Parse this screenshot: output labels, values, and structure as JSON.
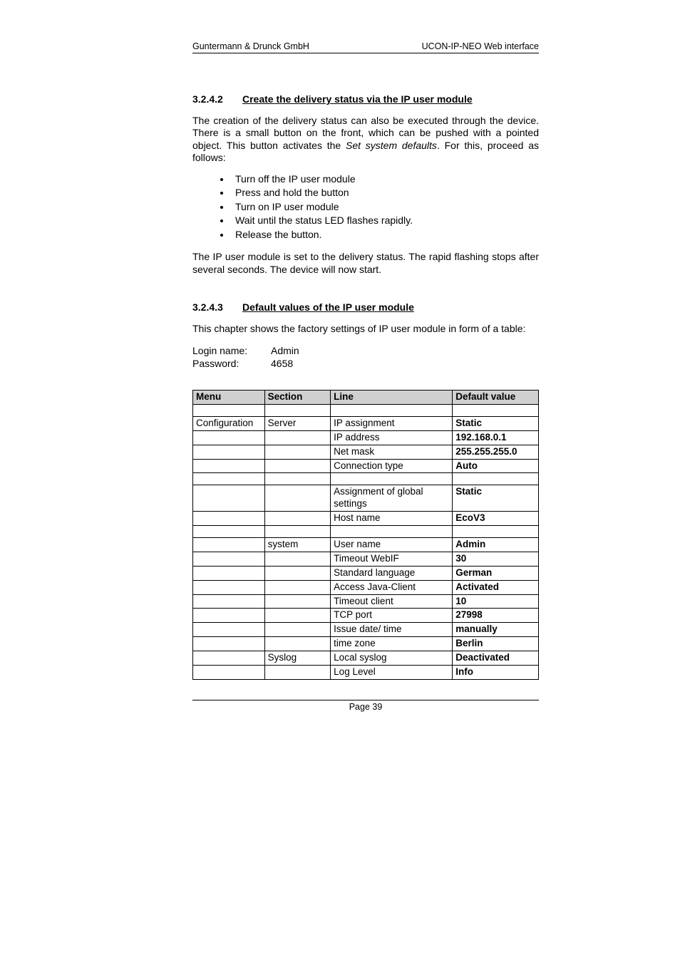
{
  "header": {
    "left": "Guntermann & Drunck GmbH",
    "right": "UCON-IP-NEO Web interface"
  },
  "section1": {
    "num": "3.2.4.2",
    "title": "Create the delivery status via the IP user module",
    "p1a": "The creation of the delivery status can also be executed through the device. There is a small button on the front, which can be pushed with a pointed object. This button activates the ",
    "p1_em": "Set system defaults",
    "p1b": ". For this, proceed as follows:",
    "bullets": [
      "Turn off the IP user module",
      "Press and hold the button",
      "Turn on IP user module",
      "Wait until the status LED flashes rapidly.",
      "Release the button."
    ],
    "p2": "The IP user module is set to the delivery status. The rapid flashing stops after several seconds. The device will now start."
  },
  "section2": {
    "num": "3.2.4.3",
    "title": "Default values of the IP user module",
    "intro": "This chapter shows the factory settings of IP user module in form of a table:",
    "login_label": "Login name:",
    "login_value": "Admin",
    "password_label": "Password:",
    "password_value": "4658"
  },
  "table": {
    "headers": {
      "menu": "Menu",
      "section": "Section",
      "line": "Line",
      "value": "Default value"
    },
    "rows": [
      {
        "type": "spacer"
      },
      {
        "menu": "Configuration",
        "section": "Server",
        "line": "IP assignment",
        "value": "Static"
      },
      {
        "menu": "",
        "section": "",
        "line": "IP address",
        "value": "192.168.0.1"
      },
      {
        "menu": "",
        "section": "",
        "line": "Net mask",
        "value": "255.255.255.0"
      },
      {
        "menu": "",
        "section": "",
        "line": "Connection type",
        "value": "Auto"
      },
      {
        "type": "spacer"
      },
      {
        "menu": "",
        "section": "",
        "line": "Assignment of global settings",
        "value": "Static"
      },
      {
        "menu": "",
        "section": "",
        "line": "Host name",
        "value": "EcoV3"
      },
      {
        "type": "spacer"
      },
      {
        "menu": "",
        "section": "system",
        "line": "User name",
        "value": "Admin"
      },
      {
        "menu": "",
        "section": "",
        "line": "Timeout WebIF",
        "value": "30"
      },
      {
        "menu": "",
        "section": "",
        "line": "Standard language",
        "value": "German"
      },
      {
        "menu": "",
        "section": "",
        "line": "Access Java-Client",
        "value": "Activated"
      },
      {
        "menu": "",
        "section": "",
        "line": "Timeout client",
        "value": "10"
      },
      {
        "menu": "",
        "section": "",
        "line": "TCP port",
        "value": "27998"
      },
      {
        "menu": "",
        "section": "",
        "line": "Issue date/ time",
        "value": "manually"
      },
      {
        "menu": "",
        "section": "",
        "line": "time zone",
        "value": "Berlin"
      },
      {
        "menu": "",
        "section": "Syslog",
        "line": "Local syslog",
        "value": "Deactivated"
      },
      {
        "menu": "",
        "section": "",
        "line": "Log Level",
        "value": "Info"
      }
    ]
  },
  "footer": "Page 39"
}
